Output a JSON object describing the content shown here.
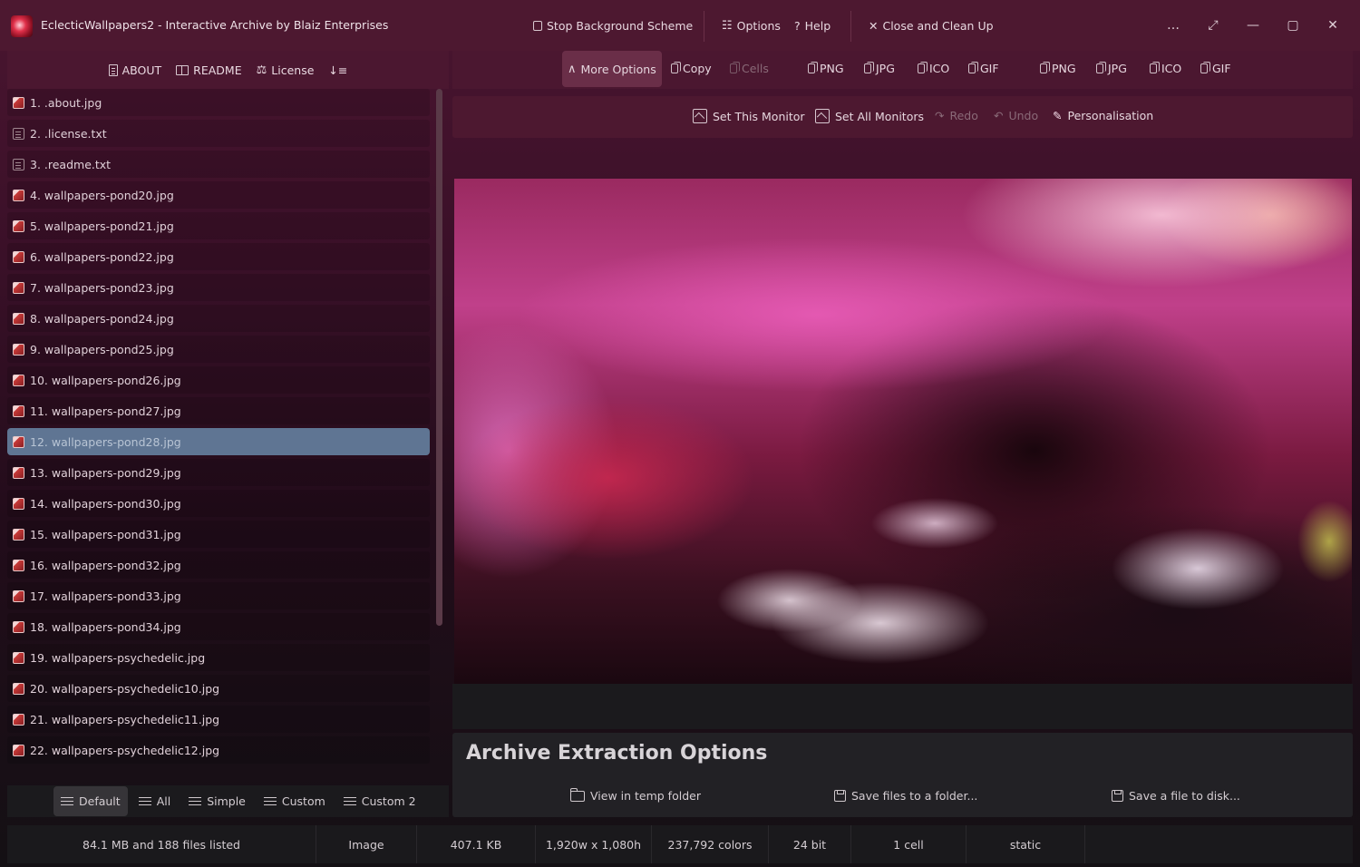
{
  "window": {
    "title": "EclecticWallpapers2  -  Interactive Archive by Blaiz Enterprises",
    "stop_bg": "Stop Background Scheme",
    "options": "Options",
    "help": "Help",
    "close_cleanup": "Close and Clean Up",
    "more_icon": "…",
    "expand_icon": "⤢",
    "minimize_icon": "—",
    "maximize_icon": "▢",
    "close_icon": "✕"
  },
  "left_toolbar": {
    "about": "ABOUT",
    "readme": "README",
    "license": "License",
    "sort_icon": "↓≡"
  },
  "right_toolbar": {
    "more_options": "More Options",
    "copy": "Copy",
    "cells": "Cells",
    "formats_a": [
      "PNG",
      "JPG",
      "ICO",
      "GIF"
    ],
    "formats_b": [
      "PNG",
      "JPG",
      "ICO",
      "GIF"
    ]
  },
  "action_bar": {
    "set_this_monitor": "Set This Monitor",
    "set_all_monitors": "Set All Monitors",
    "redo": "Redo",
    "undo": "Undo",
    "personalisation": "Personalisation"
  },
  "files": [
    {
      "label": "1. .about.jpg",
      "type": "img"
    },
    {
      "label": "2. .license.txt",
      "type": "txt"
    },
    {
      "label": "3. .readme.txt",
      "type": "txt"
    },
    {
      "label": "4. wallpapers-pond20.jpg",
      "type": "img"
    },
    {
      "label": "5. wallpapers-pond21.jpg",
      "type": "img"
    },
    {
      "label": "6. wallpapers-pond22.jpg",
      "type": "img"
    },
    {
      "label": "7. wallpapers-pond23.jpg",
      "type": "img"
    },
    {
      "label": "8. wallpapers-pond24.jpg",
      "type": "img"
    },
    {
      "label": "9. wallpapers-pond25.jpg",
      "type": "img"
    },
    {
      "label": "10. wallpapers-pond26.jpg",
      "type": "img"
    },
    {
      "label": "11. wallpapers-pond27.jpg",
      "type": "img"
    },
    {
      "label": "12. wallpapers-pond28.jpg",
      "type": "img",
      "selected": true
    },
    {
      "label": "13. wallpapers-pond29.jpg",
      "type": "img"
    },
    {
      "label": "14. wallpapers-pond30.jpg",
      "type": "img"
    },
    {
      "label": "15. wallpapers-pond31.jpg",
      "type": "img"
    },
    {
      "label": "16. wallpapers-pond32.jpg",
      "type": "img"
    },
    {
      "label": "17. wallpapers-pond33.jpg",
      "type": "img"
    },
    {
      "label": "18. wallpapers-pond34.jpg",
      "type": "img"
    },
    {
      "label": "19. wallpapers-psychedelic.jpg",
      "type": "img"
    },
    {
      "label": "20. wallpapers-psychedelic10.jpg",
      "type": "img"
    },
    {
      "label": "21. wallpapers-psychedelic11.jpg",
      "type": "img"
    },
    {
      "label": "22. wallpapers-psychedelic12.jpg",
      "type": "img"
    }
  ],
  "view_modes": {
    "default": "Default",
    "all": "All",
    "simple": "Simple",
    "custom": "Custom",
    "custom2": "Custom 2"
  },
  "extract": {
    "title": "Archive Extraction Options",
    "view_temp": "View in temp folder",
    "save_folder": "Save files to a folder...",
    "save_disk": "Save a file to disk..."
  },
  "status": {
    "summary": "84.1 MB and 188 files listed",
    "kind": "Image",
    "size": "407.1 KB",
    "dimensions": "1,920w x 1,080h",
    "colors": "237,792 colors",
    "bits": "24 bit",
    "cells": "1 cell",
    "mode": "static"
  },
  "colors": {
    "accent": "#4b1730",
    "selection": "#5f7593"
  }
}
